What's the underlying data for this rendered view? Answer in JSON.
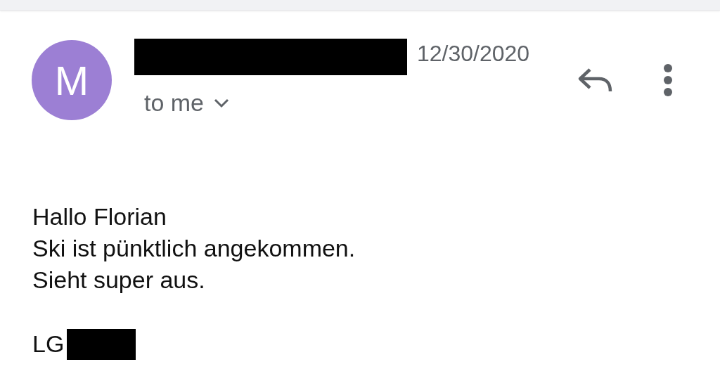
{
  "message": {
    "avatar_letter": "M",
    "sender_redacted": true,
    "date": "12/30/2020",
    "recipient": "to me"
  },
  "body": {
    "lines": [
      "Hallo Florian",
      "Ski ist pünktlich angekommen.",
      "Sieht super aus."
    ],
    "signature": "LG",
    "signature_redacted": true
  }
}
